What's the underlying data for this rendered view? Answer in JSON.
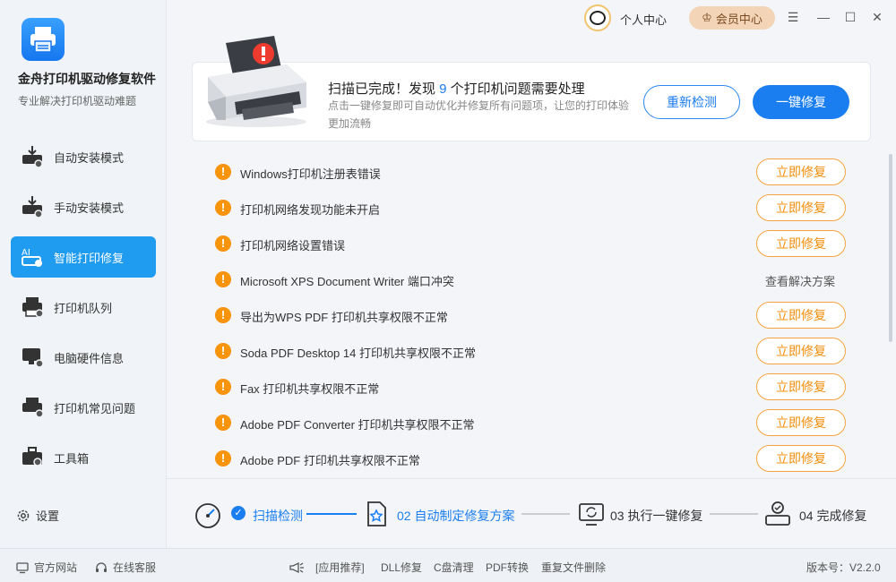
{
  "app": {
    "title": "金舟打印机驱动修复软件",
    "subtitle": "专业解决打印机驱动难题"
  },
  "topbar": {
    "user_center": "个人中心",
    "vip_center": "会员中心"
  },
  "sidebar": {
    "items": [
      {
        "label": "自动安装模式",
        "icon": "printer-download-icon"
      },
      {
        "label": "手动安装模式",
        "icon": "printer-manual-icon"
      },
      {
        "label": "智能打印修复",
        "icon": "ai-repair-icon",
        "active": true
      },
      {
        "label": "打印机队列",
        "icon": "printer-queue-icon"
      },
      {
        "label": "电脑硬件信息",
        "icon": "computer-info-icon"
      },
      {
        "label": "打印机常见问题",
        "icon": "printer-faq-icon"
      },
      {
        "label": "工具箱",
        "icon": "toolbox-icon"
      }
    ],
    "settings": "设置"
  },
  "banner": {
    "title_prefix": "扫描已完成！发现 ",
    "count": "9",
    "title_suffix": " 个打印机问题需要处理",
    "desc": "点击一键修复即可自动优化并修复所有问题项，让您的打印体验更加流畅",
    "rescan": "重新检测",
    "fix_all": "一键修复"
  },
  "issues": [
    {
      "text": "Windows打印机注册表错误",
      "action": "立即修复"
    },
    {
      "text": "打印机网络发现功能未开启",
      "action": "立即修复"
    },
    {
      "text": "打印机网络设置错误",
      "action": "立即修复"
    },
    {
      "text": "Microsoft XPS Document Writer 端口冲突",
      "action": "查看解决方案"
    },
    {
      "text": "导出为WPS PDF 打印机共享权限不正常",
      "action": "立即修复"
    },
    {
      "text": "Soda PDF Desktop 14 打印机共享权限不正常",
      "action": "立即修复"
    },
    {
      "text": "Fax 打印机共享权限不正常",
      "action": "立即修复"
    },
    {
      "text": "Adobe PDF Converter 打印机共享权限不正常",
      "action": "立即修复"
    },
    {
      "text": "Adobe PDF 打印机共享权限不正常",
      "action": "立即修复"
    }
  ],
  "steps": [
    {
      "label": "扫描检测",
      "state": "done"
    },
    {
      "label": "02 自动制定修复方案",
      "state": "current"
    },
    {
      "label": "03 执行一键修复",
      "state": "pending"
    },
    {
      "label": "04 完成修复",
      "state": "pending"
    }
  ],
  "footer": {
    "website": "官方网站",
    "support": "在线客服",
    "recommend": "[应用推荐]",
    "links": [
      "DLL修复",
      "C盘清理",
      "PDF转换",
      "重复文件删除"
    ],
    "version": "版本号：V2.2.0"
  },
  "colors": {
    "accent": "#1b7ef0",
    "warning": "#f8930c",
    "vip_bg": "#f3d4b6"
  }
}
